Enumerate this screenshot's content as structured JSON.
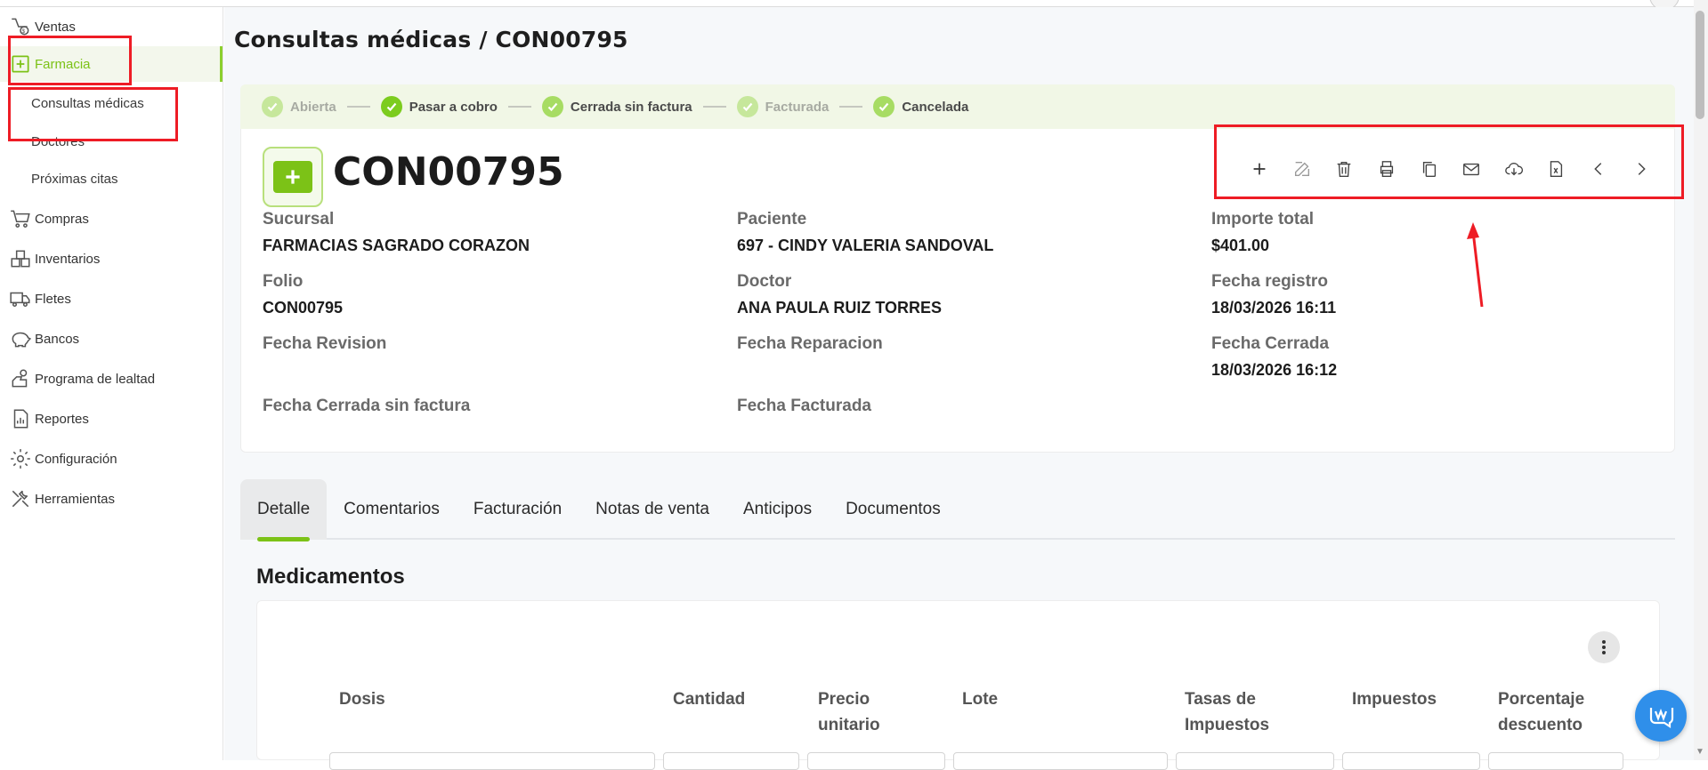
{
  "sidebar": {
    "items": [
      {
        "label": "Ventas",
        "icon": "sales-icon"
      },
      {
        "label": "Farmacia",
        "icon": "pharmacy-icon"
      },
      {
        "label": "Compras",
        "icon": "cart-icon"
      },
      {
        "label": "Inventarios",
        "icon": "boxes-icon"
      },
      {
        "label": "Fletes",
        "icon": "truck-icon"
      },
      {
        "label": "Bancos",
        "icon": "piggy-bank-icon"
      },
      {
        "label": "Programa de lealtad",
        "icon": "loyalty-icon"
      },
      {
        "label": "Reportes",
        "icon": "report-icon"
      },
      {
        "label": "Configuración",
        "icon": "gear-icon"
      },
      {
        "label": "Herramientas",
        "icon": "tools-icon"
      }
    ],
    "farmacia_sub": [
      "Consultas médicas",
      "Doctores",
      "Próximas citas"
    ]
  },
  "header": {
    "title": "Consultas médicas /  CON00795"
  },
  "steps": [
    "Abierta",
    "Pasar a cobro",
    "Cerrada sin factura",
    "Facturada",
    "Cancelada"
  ],
  "document": {
    "folio_big": "CON00795",
    "toolbar": [
      "plus-icon",
      "edit-icon",
      "trash-icon",
      "print-icon",
      "copy-icon",
      "mail-icon",
      "cloud-download-icon",
      "excel-icon",
      "chevron-left-icon",
      "chevron-right-icon"
    ],
    "fields": {
      "sucursal_label": "Sucursal",
      "sucursal_value": "FARMACIAS SAGRADO CORAZON",
      "paciente_label": "Paciente",
      "paciente_value": "697 - CINDY VALERIA SANDOVAL",
      "importe_label": "Importe total",
      "importe_value": "$401.00",
      "folio_label": "Folio",
      "folio_value": "CON00795",
      "doctor_label": "Doctor",
      "doctor_value": "ANA PAULA RUIZ TORRES",
      "fecha_registro_label": "Fecha registro",
      "fecha_registro_value": "18/03/2026 16:11",
      "fecha_revision_label": "Fecha Revision",
      "fecha_reparacion_label": "Fecha Reparacion",
      "fecha_cerrada_label": "Fecha Cerrada",
      "fecha_cerrada_value": "18/03/2026 16:12",
      "fecha_cerrada_sf_label": "Fecha Cerrada sin factura",
      "fecha_facturada_label": "Fecha Facturada"
    }
  },
  "tabs": [
    "Detalle",
    "Comentarios",
    "Facturación",
    "Notas de venta",
    "Anticipos",
    "Documentos"
  ],
  "medicamentos": {
    "title": "Medicamentos",
    "columns": [
      "Dosis",
      "Cantidad",
      "Precio unitario",
      "Lote",
      "Tasas de Impuestos",
      "Impuestos",
      "Porcentaje descuento"
    ]
  },
  "colors": {
    "accent": "#7cc217",
    "annotation": "#ee1c25",
    "chat": "#2f8fea"
  }
}
